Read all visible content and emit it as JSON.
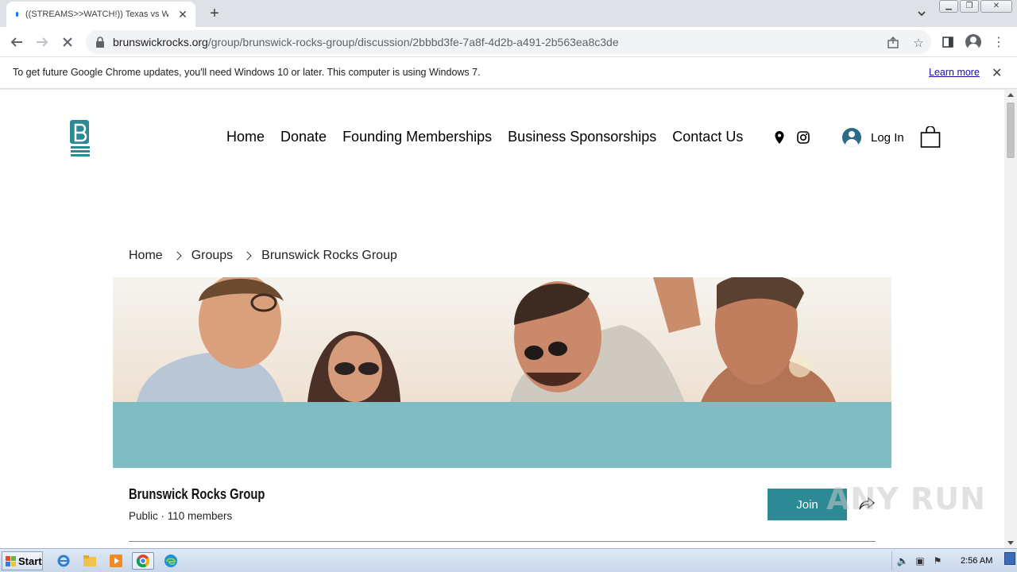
{
  "browser": {
    "tab_title": "((STREAMS>>WATCH!)) Texas vs W",
    "url_host": "brunswickrocks.org",
    "url_path": "/group/brunswick-rocks-group/discussion/2bbbd3fe-7a8f-4d2b-a491-2b563ea8c3de",
    "infobar_message": "To get future Google Chrome updates, you'll need Windows 10 or later. This computer is using Windows 7.",
    "infobar_link": "Learn more"
  },
  "site": {
    "nav": [
      "Home",
      "Donate",
      "Founding Memberships",
      "Business Sponsorships",
      "Contact Us"
    ],
    "login_label": "Log In",
    "accent_color": "#2b8a94",
    "cover_color": "#80bdc3"
  },
  "breadcrumb": [
    "Home",
    "Groups",
    "Brunswick Rocks Group"
  ],
  "group": {
    "name": "Brunswick Rocks Group",
    "meta": "Public · 110 members",
    "join_label": "Join"
  },
  "watermark": "ANY RUN",
  "taskbar": {
    "start_label": "Start",
    "clock": "2:56 AM"
  }
}
